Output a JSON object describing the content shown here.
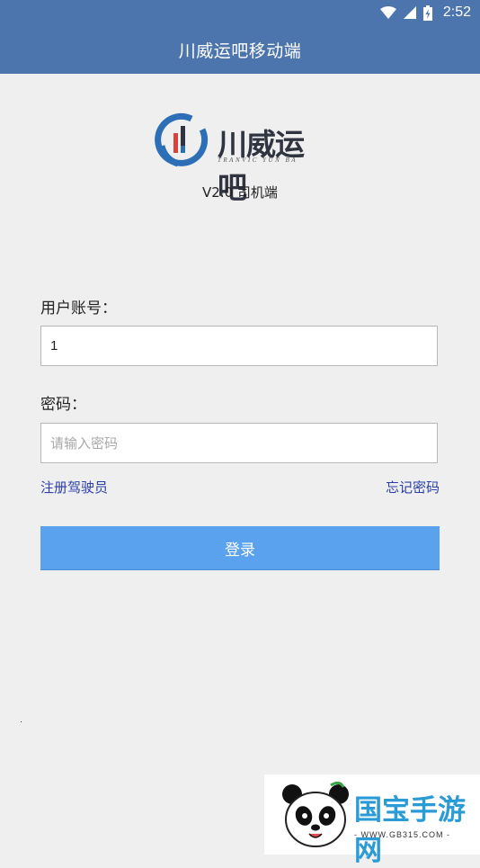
{
  "status_bar": {
    "time": "2:52",
    "icons": [
      "wifi-icon",
      "cell-signal-icon",
      "battery-charging-icon"
    ]
  },
  "app_bar": {
    "title": "川威运吧移动端"
  },
  "logo": {
    "text": "川威运吧",
    "subtitle": "TRANVIC YUN BA",
    "colors": {
      "ring": "#2d6fb7",
      "bar_red": "#d9413a",
      "bar_dark": "#2f3440"
    }
  },
  "version": "V2.0 司机端",
  "form": {
    "account_label": "用户账号：",
    "account_value": "1",
    "password_label": "密码：",
    "password_placeholder": "请输入密码",
    "register_link": "注册驾驶员",
    "forgot_link": "忘记密码",
    "login_button": "登录"
  },
  "watermark": {
    "brand": "国宝手游网",
    "url": "- WWW.GB315.COM -"
  },
  "colors": {
    "app_bar": "#4d75ad",
    "background": "#efeff0",
    "login_button": "#5aa2ee",
    "link": "#2b3fa8"
  }
}
